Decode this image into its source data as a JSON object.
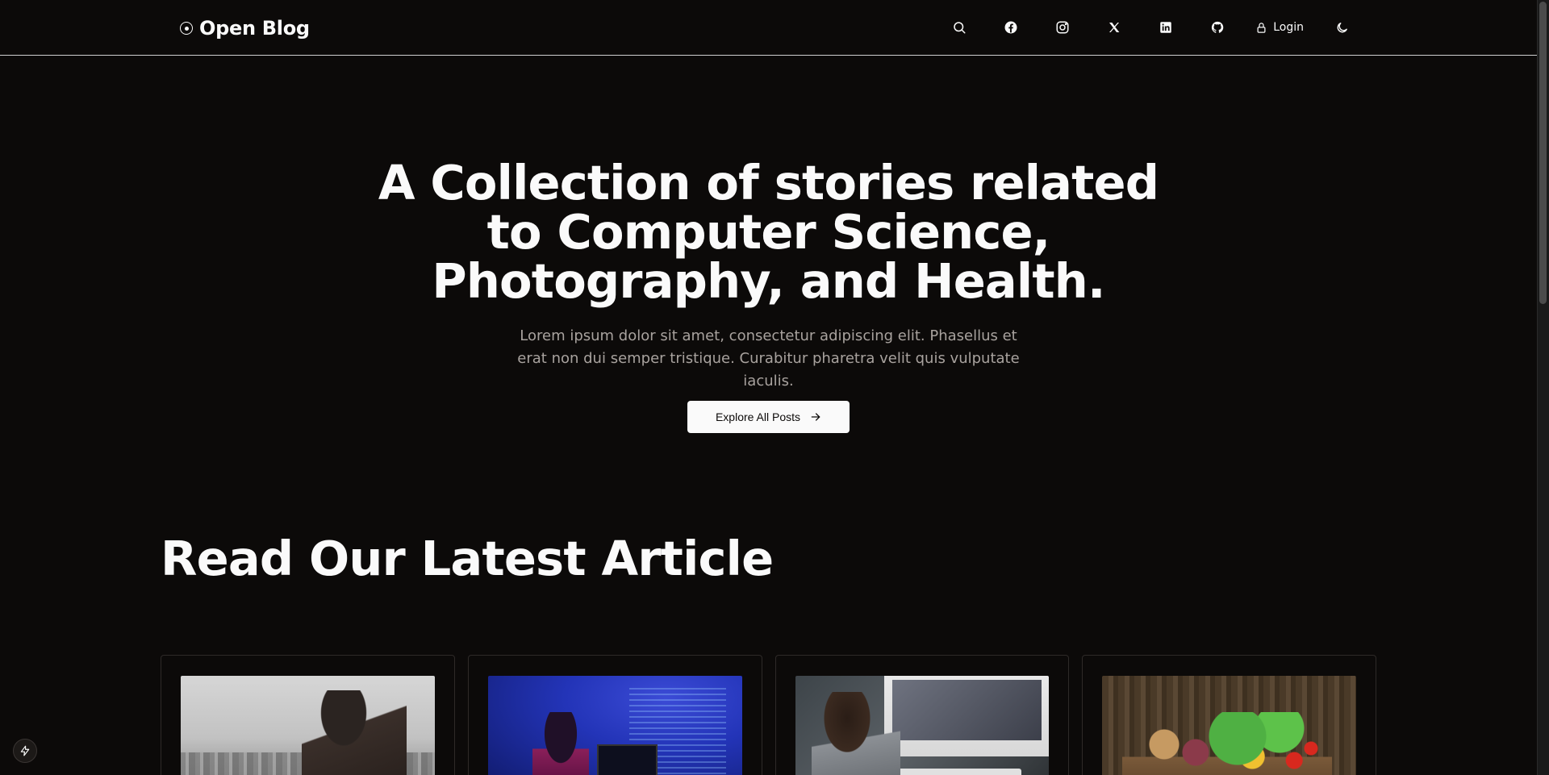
{
  "header": {
    "logo_text": "Open Blog",
    "login_label": "Login",
    "icons": [
      "search-icon",
      "facebook-icon",
      "instagram-icon",
      "x-icon",
      "linkedin-icon",
      "github-icon",
      "lock-icon",
      "moon-icon"
    ]
  },
  "hero": {
    "title": "A Collection of stories related to Computer Science, Photography, and Health.",
    "subtitle": "Lorem ipsum dolor sit amet, consectetur adipiscing elit. Phasellus et erat non dui semper tristique. Curabitur pharetra velit quis vulputate iaculis.",
    "cta_label": "Explore All Posts"
  },
  "latest": {
    "title": "Read Our Latest Article",
    "cards": [
      {
        "image": "photographer-image"
      },
      {
        "image": "coder-image"
      },
      {
        "image": "computer-user-image"
      },
      {
        "image": "vegetables-image"
      }
    ]
  },
  "colors": {
    "background": "#0c0a09",
    "foreground": "#fafafa",
    "muted": "#a8a29e",
    "border": "#2e2a28"
  }
}
